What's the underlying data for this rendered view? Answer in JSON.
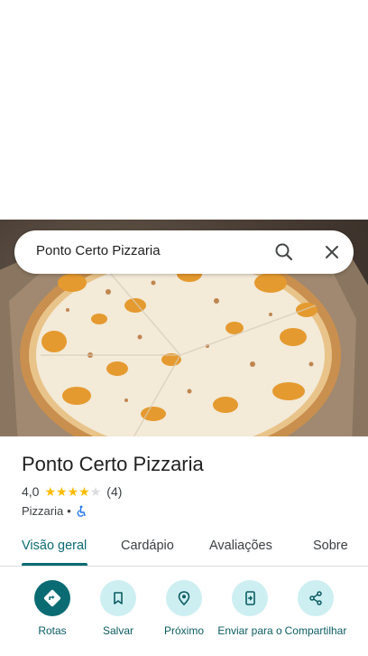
{
  "search": {
    "query": "Ponto Certo Pizzaria"
  },
  "place": {
    "title": "Ponto Certo Pizzaria",
    "rating": "4,0",
    "stars_filled": 4,
    "stars_total": 5,
    "review_count": "(4)",
    "category": "Pizzaria",
    "separator": "•"
  },
  "tabs": [
    {
      "label": "Visão geral",
      "active": true
    },
    {
      "label": "Cardápio",
      "active": false
    },
    {
      "label": "Avaliações",
      "active": false
    },
    {
      "label": "Sobre",
      "active": false
    }
  ],
  "actions": [
    {
      "label": "Rotas",
      "icon": "directions-icon"
    },
    {
      "label": "Salvar",
      "icon": "bookmark-icon"
    },
    {
      "label": "Próximo",
      "icon": "nearby-icon"
    },
    {
      "label": "Enviar para o",
      "icon": "send-to-phone-icon"
    },
    {
      "label": "Compartilhar",
      "icon": "share-icon"
    }
  ],
  "colors": {
    "accent": "#0b6b73",
    "star": "#fbbc04",
    "action_bg": "#cdeff2"
  }
}
